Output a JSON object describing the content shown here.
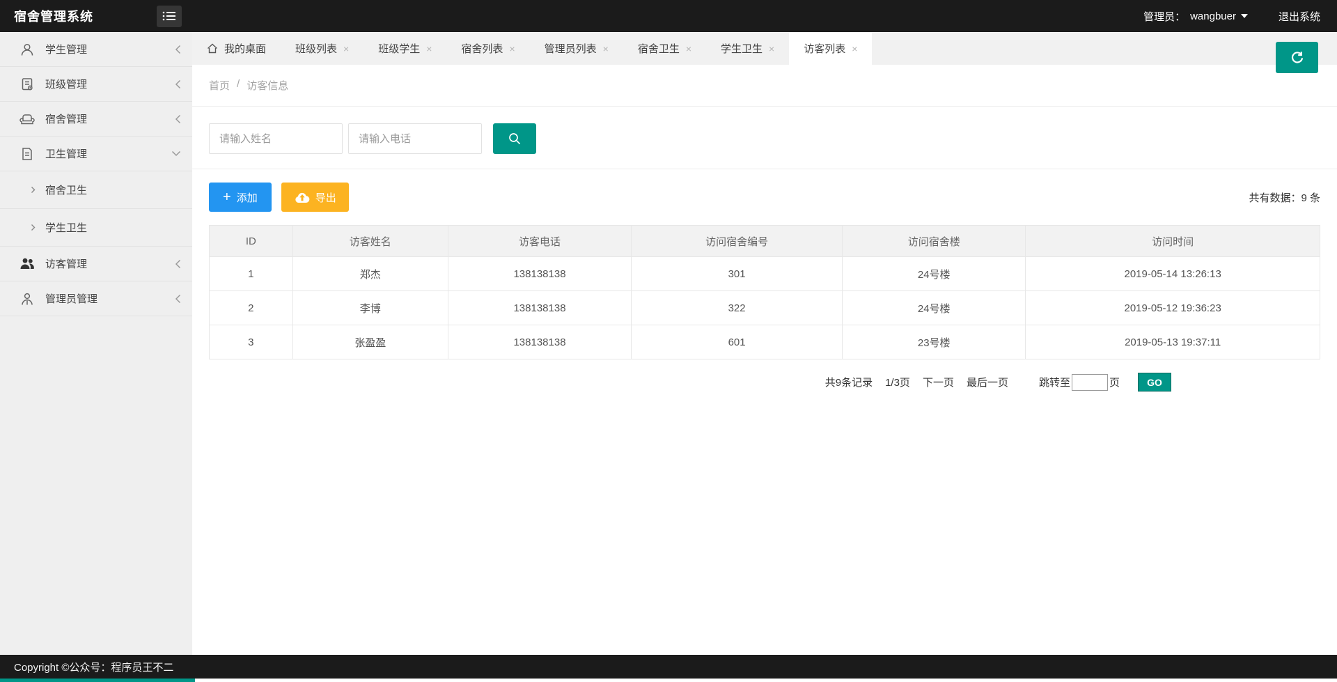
{
  "app": {
    "title": "宿舍管理系统",
    "admin_label": "管理员：",
    "admin_name": "wangbuer",
    "logout": "退出系统"
  },
  "sidebar": {
    "items": [
      {
        "label": "学生管理",
        "state": "collapsed"
      },
      {
        "label": "班级管理",
        "state": "collapsed"
      },
      {
        "label": "宿舍管理",
        "state": "collapsed"
      },
      {
        "label": "卫生管理",
        "state": "expanded"
      },
      {
        "label": "访客管理",
        "state": "collapsed"
      },
      {
        "label": "管理员管理",
        "state": "collapsed"
      }
    ],
    "hygiene_children": [
      {
        "label": "宿舍卫生"
      },
      {
        "label": "学生卫生"
      }
    ]
  },
  "tabs": [
    {
      "label": "我的桌面",
      "active": false,
      "closable": false
    },
    {
      "label": "班级列表",
      "active": false,
      "closable": true
    },
    {
      "label": "班级学生",
      "active": false,
      "closable": true
    },
    {
      "label": "宿舍列表",
      "active": false,
      "closable": true
    },
    {
      "label": "管理员列表",
      "active": false,
      "closable": true
    },
    {
      "label": "宿舍卫生",
      "active": false,
      "closable": true
    },
    {
      "label": "学生卫生",
      "active": false,
      "closable": true
    },
    {
      "label": "访客列表",
      "active": true,
      "closable": true
    }
  ],
  "close_glyph": "×",
  "breadcrumb": {
    "home": "首页",
    "separator": "/",
    "current": "访客信息"
  },
  "search": {
    "name_placeholder": "请输入姓名",
    "phone_placeholder": "请输入电话"
  },
  "toolbar": {
    "add_label": "添加",
    "export_label": "导出",
    "total_label": "共有数据：",
    "total_count": "9",
    "total_unit": "条"
  },
  "table": {
    "headers": [
      "ID",
      "访客姓名",
      "访客电话",
      "访问宿舍编号",
      "访问宿舍楼",
      "访问时间"
    ],
    "rows": [
      [
        "1",
        "郑杰",
        "138138138",
        "301",
        "24号楼",
        "2019-05-14 13:26:13"
      ],
      [
        "2",
        "李博",
        "138138138",
        "322",
        "24号楼",
        "2019-05-12 19:36:23"
      ],
      [
        "3",
        "张盈盈",
        "138138138",
        "601",
        "23号楼",
        "2019-05-13 19:37:11"
      ]
    ]
  },
  "pagination": {
    "summary": "共9条记录",
    "page_indicator": "1/3页",
    "next": "下一页",
    "last": "最后一页",
    "jump_label": "跳转至",
    "jump_unit": "页",
    "go": "GO",
    "jump_value": ""
  },
  "footer": {
    "copyright": "Copyright ©公众号：程序员王不二"
  },
  "colors": {
    "teal": "#009688",
    "blue": "#2395f1",
    "amber": "#fcb321",
    "bar_dark": "#1b1b1b",
    "sidebar_bg": "#efefef",
    "tabbar_bg": "#f1f1f1"
  }
}
